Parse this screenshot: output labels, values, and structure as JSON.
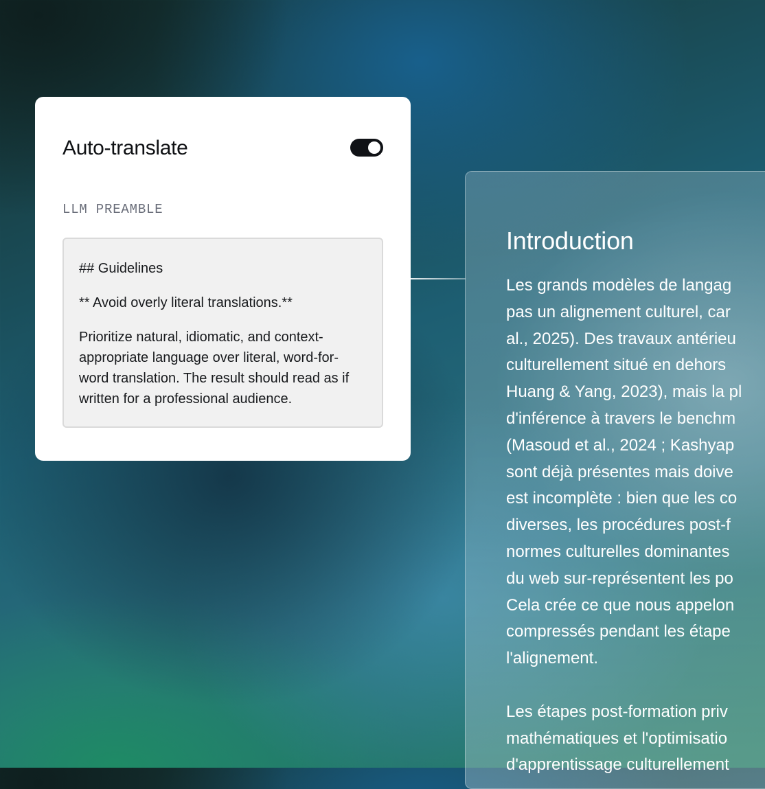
{
  "settings": {
    "title": "Auto-translate",
    "toggle_on": true,
    "preamble_label": "LLM PREAMBLE",
    "preamble": {
      "heading": "## Guidelines",
      "rule": "** Avoid overly literal translations.**",
      "body_lines": [
        "Prioritize natural, idiomatic, and context-",
        "appropriate language over literal, word-for-",
        "word translation. The result should read as if",
        "written for a professional audience."
      ]
    }
  },
  "document": {
    "heading": "Introduction",
    "paragraph1_lines": [
      "Les grands modèles de langag",
      "pas un alignement culturel, car",
      "al., 2025). Des travaux antérieu",
      "culturellement situé en dehors",
      "Huang & Yang, 2023), mais la pl",
      "d'inférence à travers le benchm",
      "(Masoud et al., 2024 ; Kashyap",
      "sont déjà présentes mais doive",
      "est incomplète : bien que les co",
      "diverses, les procédures post-f",
      "normes culturelles dominantes",
      "du web sur-représentent les po",
      "Cela crée ce que nous appelon",
      "compressés pendant les étape",
      "l'alignement."
    ],
    "paragraph2_lines": [
      "Les étapes post-formation priv",
      "mathématiques et l'optimisatio",
      "d'apprentissage culturellement"
    ]
  }
}
